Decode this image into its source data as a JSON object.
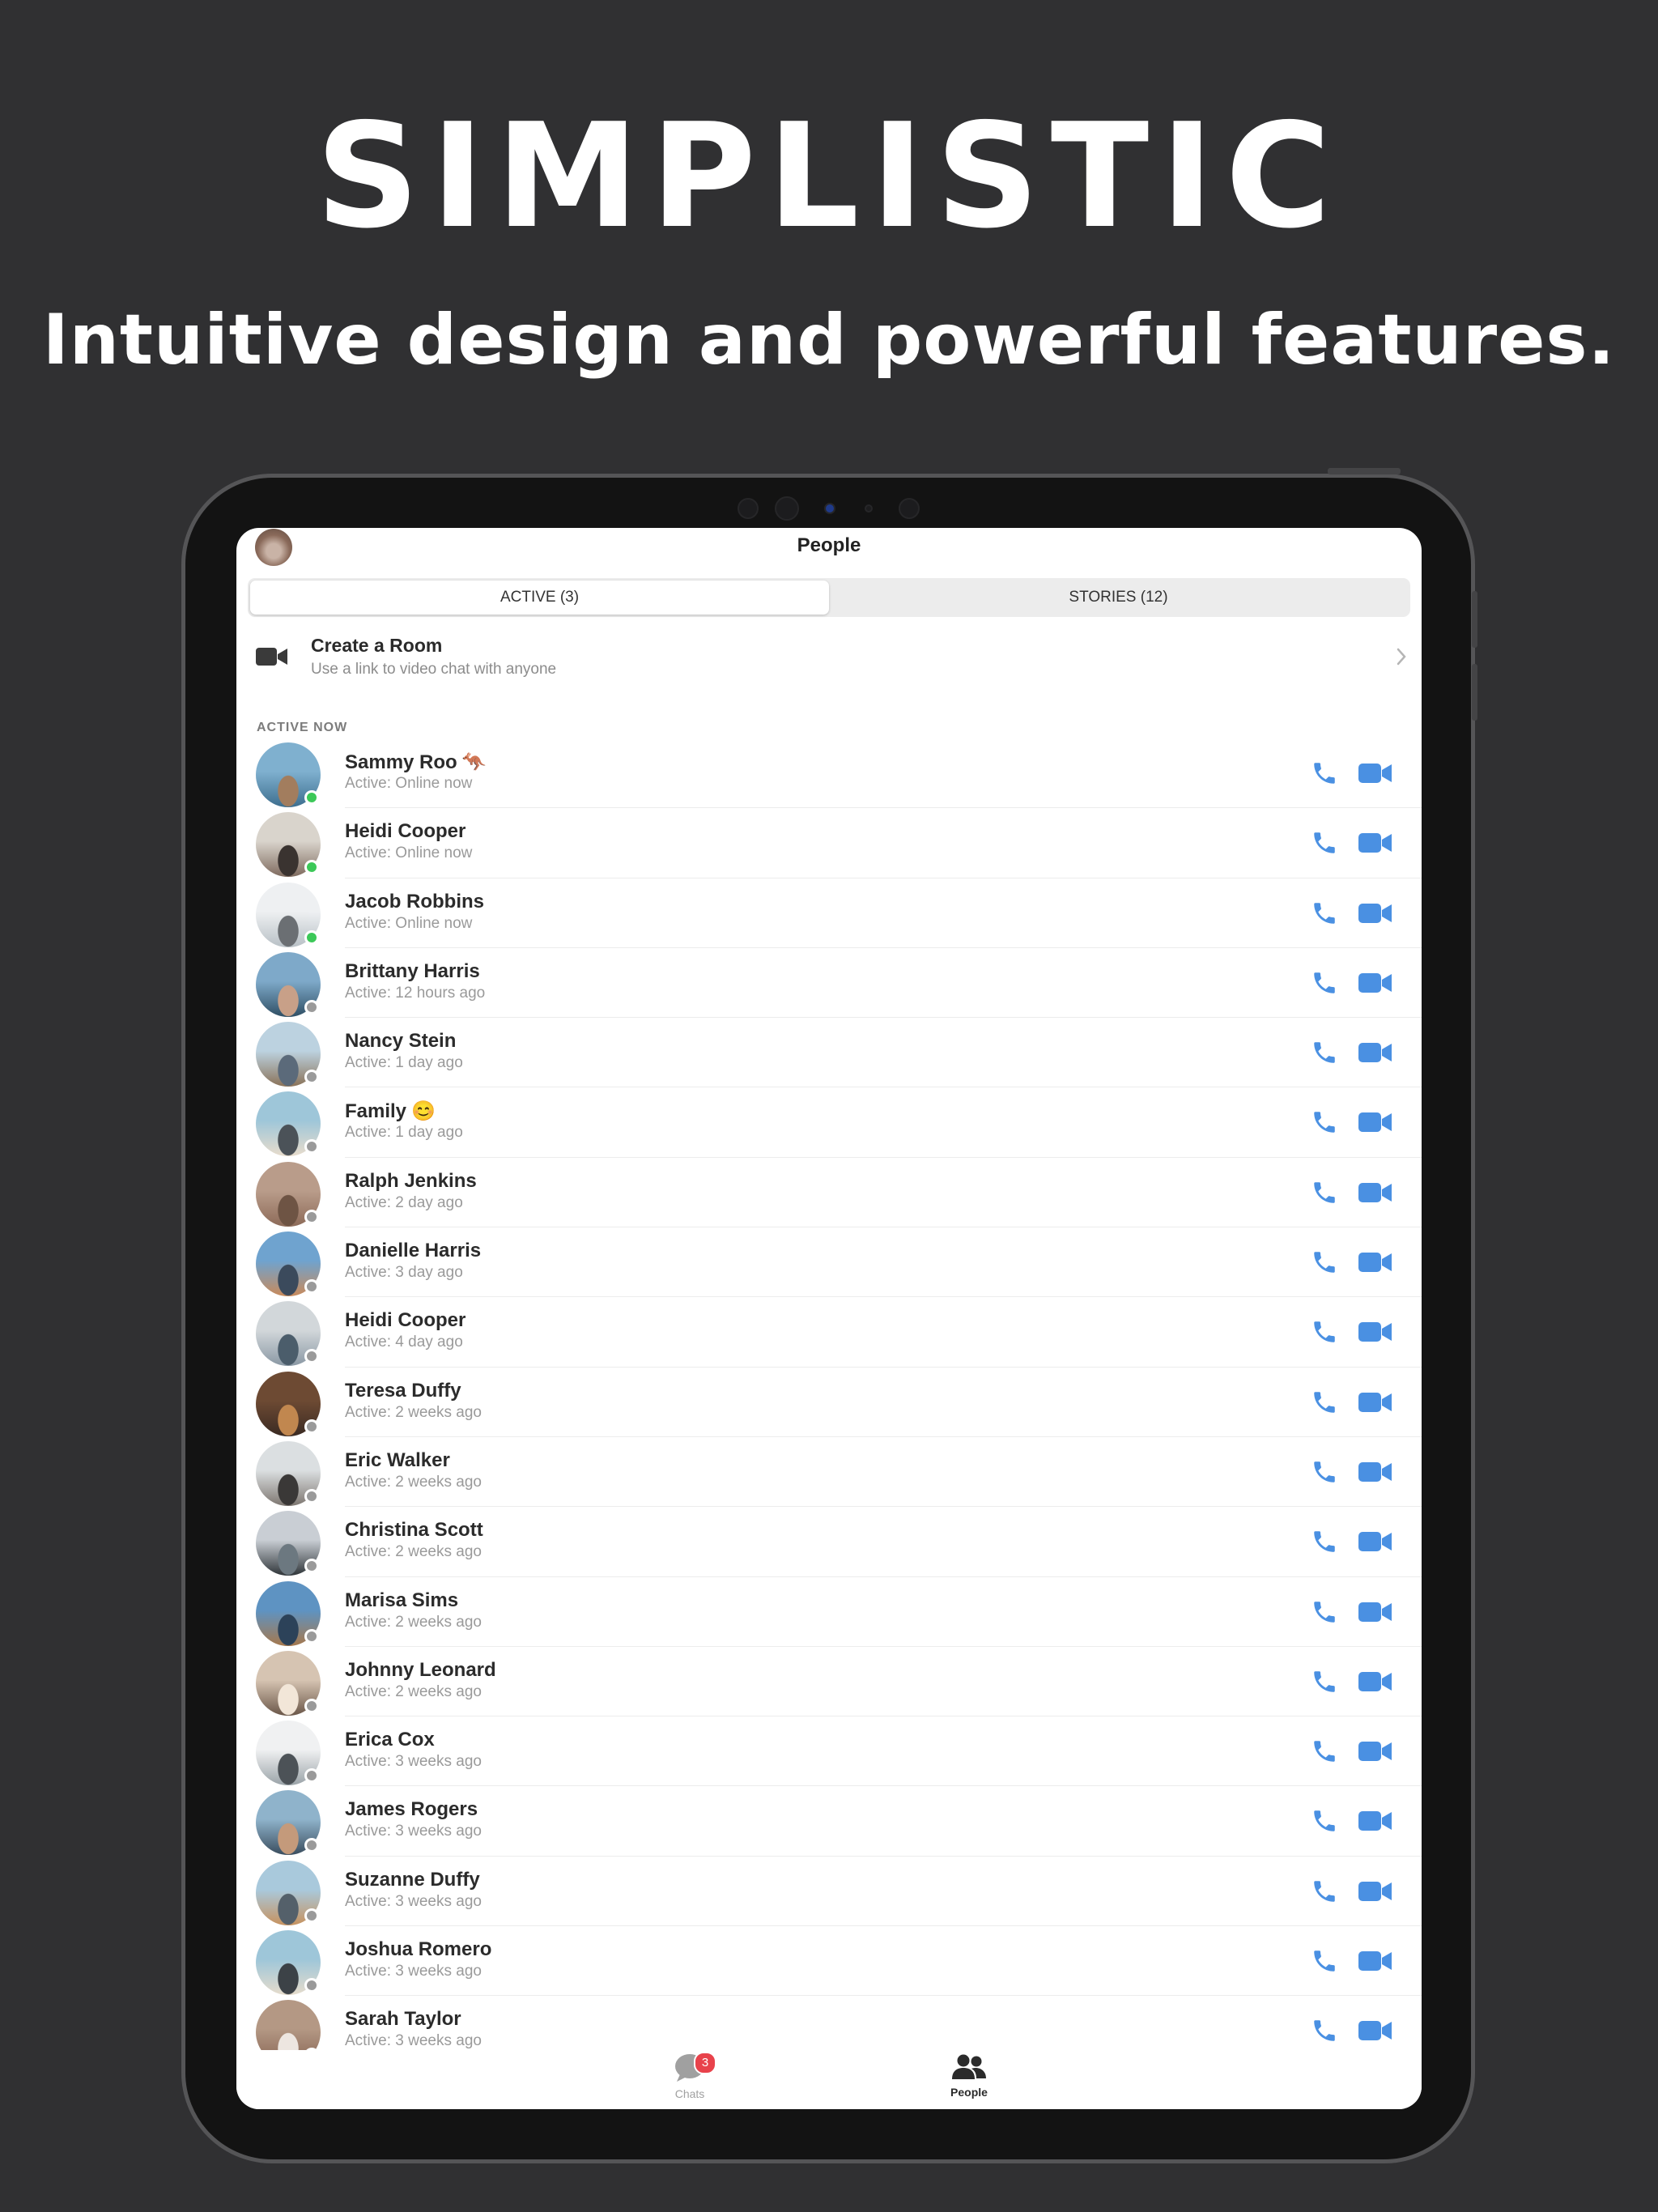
{
  "headline": "SIMPLISTIC",
  "subline": "Intuitive design and powerful features.",
  "app": {
    "title": "People",
    "tabs": [
      {
        "label": "ACTIVE (3)",
        "active": true
      },
      {
        "label": "STORIES (12)",
        "active": false
      }
    ],
    "room": {
      "title": "Create a Room",
      "subtitle": "Use a link to video chat with anyone",
      "icon": "video-camera-icon"
    },
    "section_label": "ACTIVE NOW",
    "contacts": [
      {
        "name": "Sammy Roo",
        "emoji": "🦘",
        "status": "Active: Online now",
        "online": true
      },
      {
        "name": "Heidi Cooper",
        "emoji": "",
        "status": "Active: Online now",
        "online": true
      },
      {
        "name": "Jacob Robbins",
        "emoji": "",
        "status": "Active: Online now",
        "online": true
      },
      {
        "name": "Brittany Harris",
        "emoji": "",
        "status": "Active: 12 hours ago",
        "online": false
      },
      {
        "name": "Nancy Stein",
        "emoji": "",
        "status": "Active: 1 day ago",
        "online": false
      },
      {
        "name": "Family",
        "emoji": "😊",
        "status": "Active: 1 day ago",
        "online": false
      },
      {
        "name": "Ralph Jenkins",
        "emoji": "",
        "status": "Active: 2 day ago",
        "online": false
      },
      {
        "name": "Danielle Harris",
        "emoji": "",
        "status": "Active: 3 day ago",
        "online": false
      },
      {
        "name": "Heidi Cooper",
        "emoji": "",
        "status": "Active: 4 day ago",
        "online": false
      },
      {
        "name": "Teresa Duffy",
        "emoji": "",
        "status": "Active: 2 weeks ago",
        "online": false
      },
      {
        "name": "Eric Walker",
        "emoji": "",
        "status": "Active: 2 weeks ago",
        "online": false
      },
      {
        "name": "Christina Scott",
        "emoji": "",
        "status": "Active: 2 weeks ago",
        "online": false
      },
      {
        "name": "Marisa Sims",
        "emoji": "",
        "status": "Active: 2 weeks ago",
        "online": false
      },
      {
        "name": "Johnny Leonard",
        "emoji": "",
        "status": "Active: 2 weeks ago",
        "online": false
      },
      {
        "name": "Erica Cox",
        "emoji": "",
        "status": "Active: 3 weeks ago",
        "online": false
      },
      {
        "name": "James Rogers",
        "emoji": "",
        "status": "Active: 3 weeks ago",
        "online": false
      },
      {
        "name": "Suzanne Duffy",
        "emoji": "",
        "status": "Active: 3 weeks ago",
        "online": false
      },
      {
        "name": "Joshua Romero",
        "emoji": "",
        "status": "Active: 3 weeks ago",
        "online": false
      },
      {
        "name": "Sarah Taylor",
        "emoji": "",
        "status": "Active: 3 weeks ago",
        "online": false
      }
    ],
    "tabbar": [
      {
        "label": "Chats",
        "icon": "chat-bubble-icon",
        "badge": "3",
        "active": false
      },
      {
        "label": "People",
        "icon": "people-icon",
        "badge": "",
        "active": true
      }
    ]
  },
  "colors": {
    "background": "#303032",
    "accent": "#4a90e2",
    "online": "#3cc858",
    "offline": "#9a9a9a",
    "badge": "#e8424b"
  }
}
